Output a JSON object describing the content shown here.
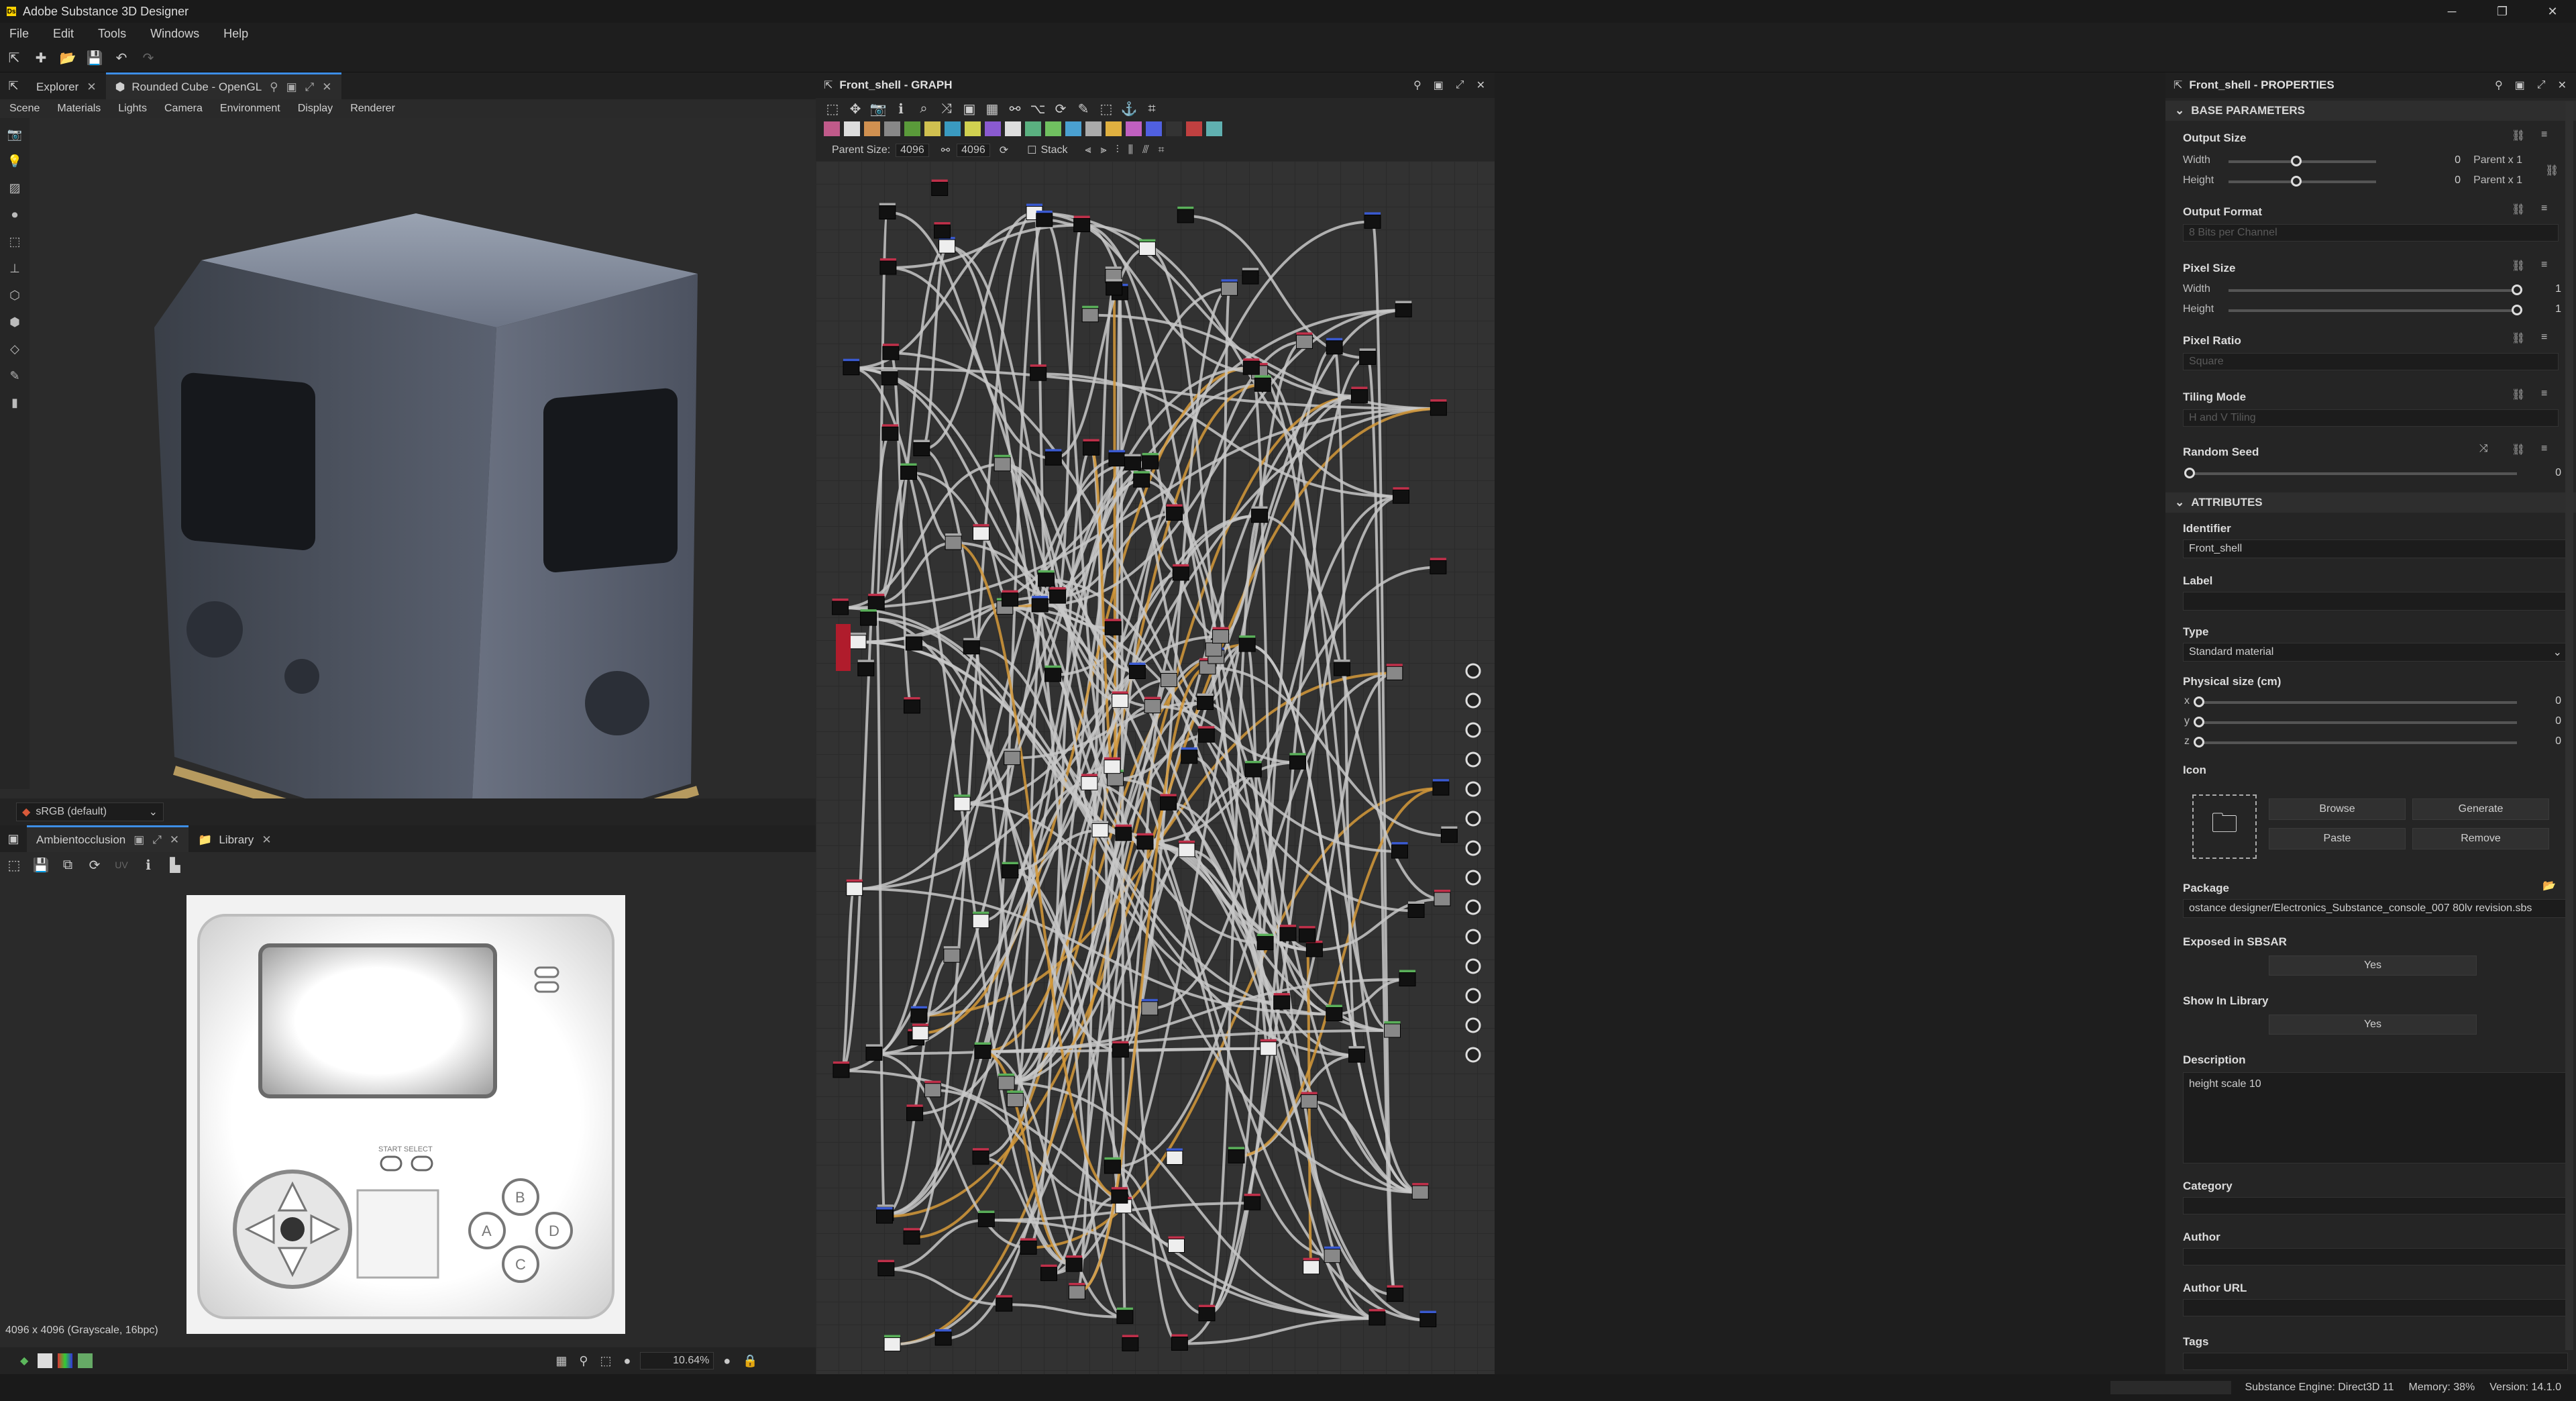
{
  "app": {
    "title": "Adobe Substance 3D Designer"
  },
  "menu": [
    "File",
    "Edit",
    "Tools",
    "Windows",
    "Help"
  ],
  "viewport3d": {
    "tabs": [
      {
        "label": "Explorer"
      },
      {
        "label": "Rounded Cube - OpenGL"
      }
    ],
    "submenu": [
      "Scene",
      "Materials",
      "Lights",
      "Camera",
      "Environment",
      "Display",
      "Renderer"
    ],
    "colorspace": "sRGB (default)"
  },
  "viewport2d": {
    "tabs": [
      {
        "label": "Ambientocclusion"
      },
      {
        "label": "Library"
      }
    ],
    "uv_label": "UV",
    "info": "4096 x 4096 (Grayscale, 16bpc)",
    "zoom": "10.64%",
    "texture_labels": {
      "btn_a": "A",
      "btn_b": "B",
      "btn_c": "C",
      "btn_d": "D",
      "start": "START SELECT"
    }
  },
  "graph": {
    "title": "Front_shell - GRAPH",
    "parent_size_label": "Parent Size:",
    "size_w": "4096",
    "size_h": "4096",
    "stack_label": "Stack"
  },
  "properties": {
    "title": "Front_shell - PROPERTIES",
    "base_section": "BASE PARAMETERS",
    "output_size": {
      "label": "Output Size",
      "width_label": "Width",
      "height_label": "Height",
      "width_value": "0",
      "height_value": "0",
      "width_mode": "Parent x 1",
      "height_mode": "Parent x 1"
    },
    "output_format": {
      "label": "Output Format",
      "value": "8 Bits per Channel"
    },
    "pixel_size": {
      "label": "Pixel Size",
      "width_label": "Width",
      "height_label": "Height",
      "width_value": "1",
      "height_value": "1"
    },
    "pixel_ratio": {
      "label": "Pixel Ratio",
      "value": "Square"
    },
    "tiling_mode": {
      "label": "Tiling Mode",
      "value": "H and V Tiling"
    },
    "random_seed": {
      "label": "Random Seed",
      "value": "0"
    },
    "attr_section": "ATTRIBUTES",
    "identifier": {
      "label": "Identifier",
      "value": "Front_shell"
    },
    "label": {
      "label": "Label",
      "value": ""
    },
    "type": {
      "label": "Type",
      "value": "Standard material"
    },
    "physical_size": {
      "label": "Physical size (cm)",
      "x_label": "x",
      "y_label": "y",
      "z_label": "z",
      "x": "0",
      "y": "0",
      "z": "0"
    },
    "icon": {
      "label": "Icon",
      "browse": "Browse",
      "generate": "Generate",
      "paste": "Paste",
      "remove": "Remove"
    },
    "package": {
      "label": "Package",
      "value": "ostance designer/Electronics_Substance_console_007 80lv revision.sbs"
    },
    "exposed": {
      "label": "Exposed in SBSAR",
      "value": "Yes"
    },
    "show_library": {
      "label": "Show In Library",
      "value": "Yes"
    },
    "description": {
      "label": "Description",
      "value": "height scale 10"
    },
    "category": {
      "label": "Category"
    },
    "author": {
      "label": "Author"
    },
    "author_url": {
      "label": "Author URL"
    },
    "tags": {
      "label": "Tags"
    }
  },
  "status": {
    "engine": "Substance Engine: Direct3D 11",
    "memory": "Memory: 38%",
    "version": "Version: 14.1.0"
  }
}
